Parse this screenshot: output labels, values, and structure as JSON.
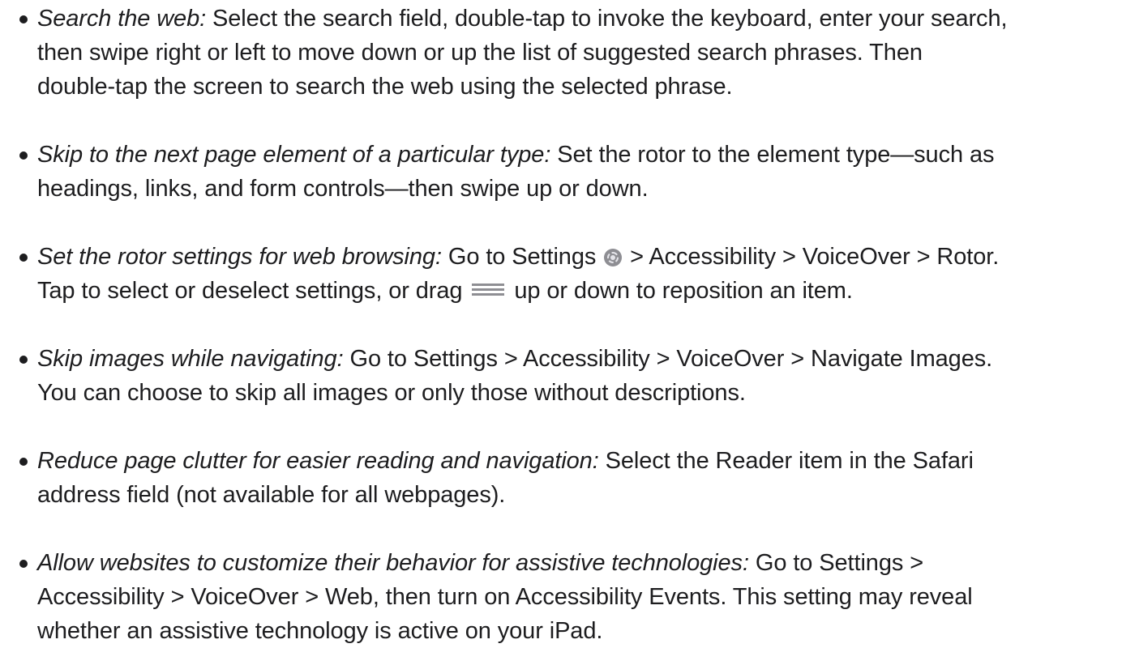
{
  "items": [
    {
      "lines": [
        {
          "topic": "Search the web:",
          "text": " Select the search field, double-tap to invoke the keyboard, enter your search,"
        },
        {
          "text": "then swipe right or left to move down or up the list of suggested search phrases. Then"
        },
        {
          "text": "double-tap the screen to search the web using the selected phrase."
        }
      ]
    },
    {
      "lines": [
        {
          "topic": "Skip to the next page element of a particular type:",
          "text": " Set the rotor to the element type—such as"
        },
        {
          "text": "headings, links, and form controls—then swipe up or down."
        }
      ]
    },
    {
      "lines": [
        {
          "topic": "Set the rotor settings for web browsing:",
          "pre_icon": " Go to Settings",
          "post_icon": " > Accessibility > VoiceOver > Rotor."
        },
        {
          "pre_icon": "Tap to select or deselect settings, or drag",
          "post_icon": " up or down to reposition an item."
        }
      ]
    },
    {
      "lines": [
        {
          "topic": "Skip images while navigating:",
          "text": " Go to Settings > Accessibility > VoiceOver > Navigate Images."
        },
        {
          "text": "You can choose to skip all images or only those without descriptions."
        }
      ]
    },
    {
      "lines": [
        {
          "topic": "Reduce page clutter for easier reading and navigation:",
          "text": " Select the Reader item in the Safari"
        },
        {
          "text": "address field (not available for all webpages)."
        }
      ]
    },
    {
      "lines": [
        {
          "topic": "Allow websites to customize their behavior for assistive technologies:",
          "text": " Go to Settings >"
        },
        {
          "text": "Accessibility > VoiceOver > Web, then turn on Accessibility Events. This setting may reveal"
        },
        {
          "text": "whether an assistive technology is active on your iPad."
        }
      ]
    }
  ],
  "icons": {
    "settings": "settings-gear-icon",
    "reorder": "reorder-handle-icon"
  }
}
